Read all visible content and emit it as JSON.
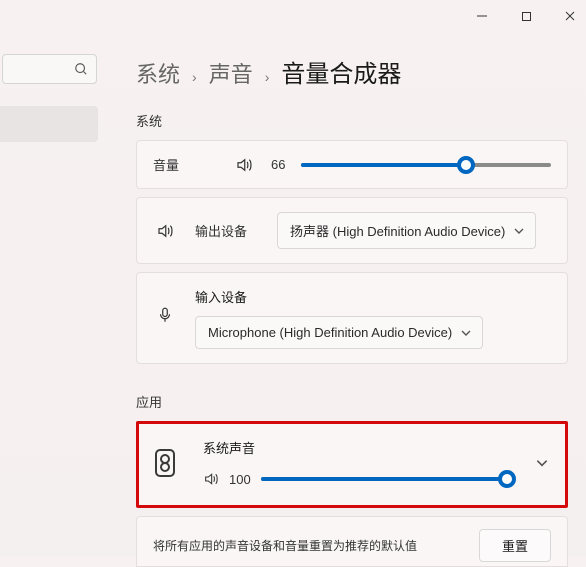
{
  "window": {
    "minimize_title": "Minimize",
    "maximize_title": "Maximize",
    "close_title": "Close"
  },
  "breadcrumb": {
    "root": "系统",
    "mid": "声音",
    "current": "音量合成器"
  },
  "sections": {
    "system": "系统",
    "apps": "应用"
  },
  "volume": {
    "label": "音量",
    "value": "66",
    "percent": 66
  },
  "output": {
    "label": "输出设备",
    "selected": "扬声器 (High Definition Audio Device)"
  },
  "input": {
    "label": "输入设备",
    "selected": "Microphone (High Definition Audio Device)"
  },
  "app_volume": {
    "title": "系统声音",
    "value": "100",
    "percent": 100
  },
  "reset": {
    "text": "将所有应用的声音设备和音量重置为推荐的默认值",
    "button": "重置"
  }
}
